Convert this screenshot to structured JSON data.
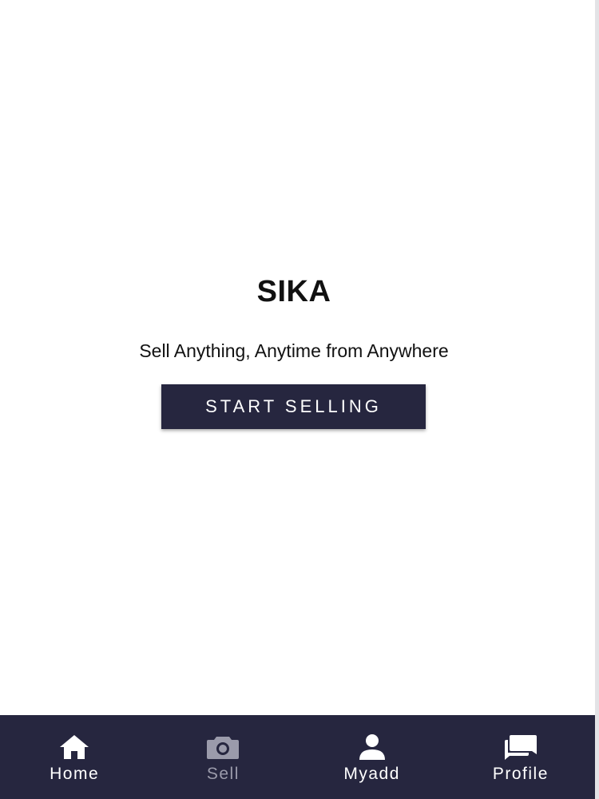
{
  "app": {
    "title": "SIKA",
    "tagline": "Sell Anything, Anytime from Anywhere",
    "cta_label": "START SELLING"
  },
  "bottom_nav": {
    "items": [
      {
        "label": "Home",
        "icon": "home-icon",
        "active": true
      },
      {
        "label": "Sell",
        "icon": "camera-icon",
        "active": false
      },
      {
        "label": "Myadd",
        "icon": "person-icon",
        "active": true
      },
      {
        "label": "Profile",
        "icon": "chat-icon",
        "active": true
      }
    ]
  },
  "colors": {
    "primary": "#26263f",
    "text": "#111111",
    "nav_inactive": "#9b9bab"
  }
}
